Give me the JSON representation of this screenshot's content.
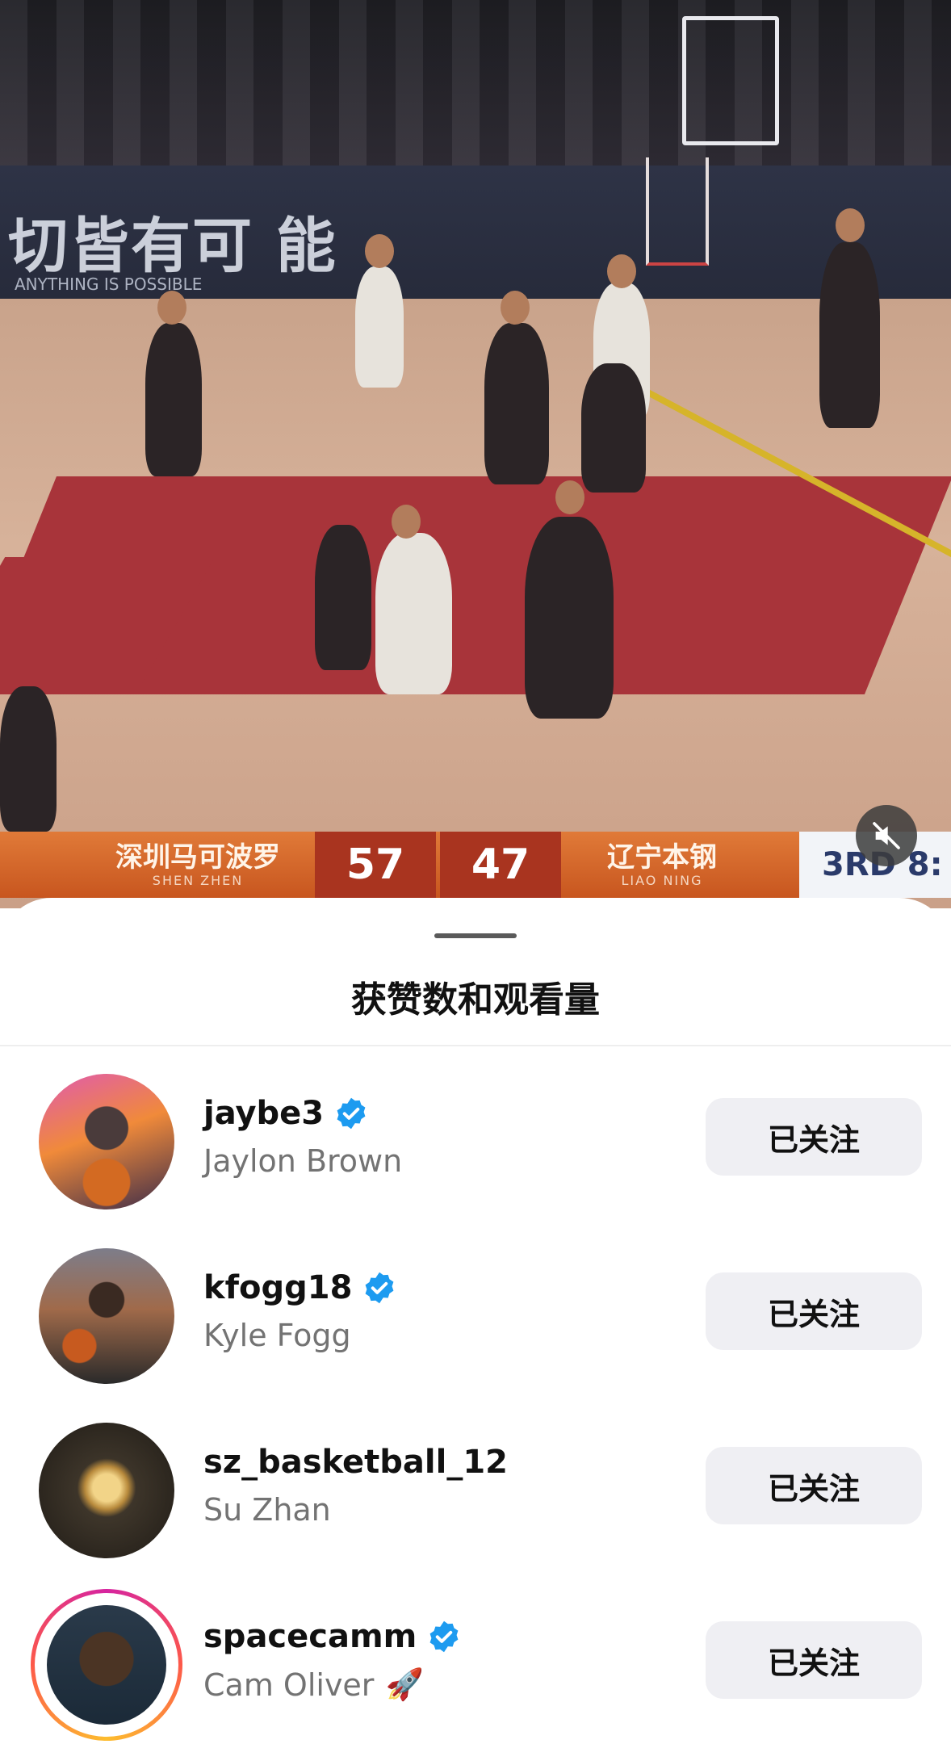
{
  "video": {
    "board_text": "切皆有可 能",
    "board_sub": "ANYTHING IS POSSIBLE",
    "home_team": "深圳马可波罗",
    "home_team_en": "SHEN ZHEN",
    "home_score": "57",
    "away_score": "47",
    "away_team": "辽宁本钢",
    "away_team_en": "LIAO NING",
    "period": "3RD 8:",
    "mute_icon": "muted-speaker-icon"
  },
  "sheet": {
    "title": "获赞数和观看量",
    "users": [
      {
        "username": "jaybe3",
        "full_name": "Jaylon Brown",
        "verified": true,
        "button": "已关注",
        "story_ring": false,
        "emoji": ""
      },
      {
        "username": "kfogg18",
        "full_name": "Kyle Fogg",
        "verified": true,
        "button": "已关注",
        "story_ring": false,
        "emoji": ""
      },
      {
        "username": "sz_basketball_12",
        "full_name": "Su Zhan",
        "verified": false,
        "button": "已关注",
        "story_ring": false,
        "emoji": ""
      },
      {
        "username": "spacecamm",
        "full_name": "Cam Oliver",
        "verified": true,
        "button": "已关注",
        "story_ring": true,
        "emoji": "🚀"
      }
    ]
  },
  "colors": {
    "verified_blue": "#1d9bf0",
    "button_bg": "#efeff3",
    "secondary_text": "#737373",
    "scorebug_orange": "#e07a38"
  }
}
